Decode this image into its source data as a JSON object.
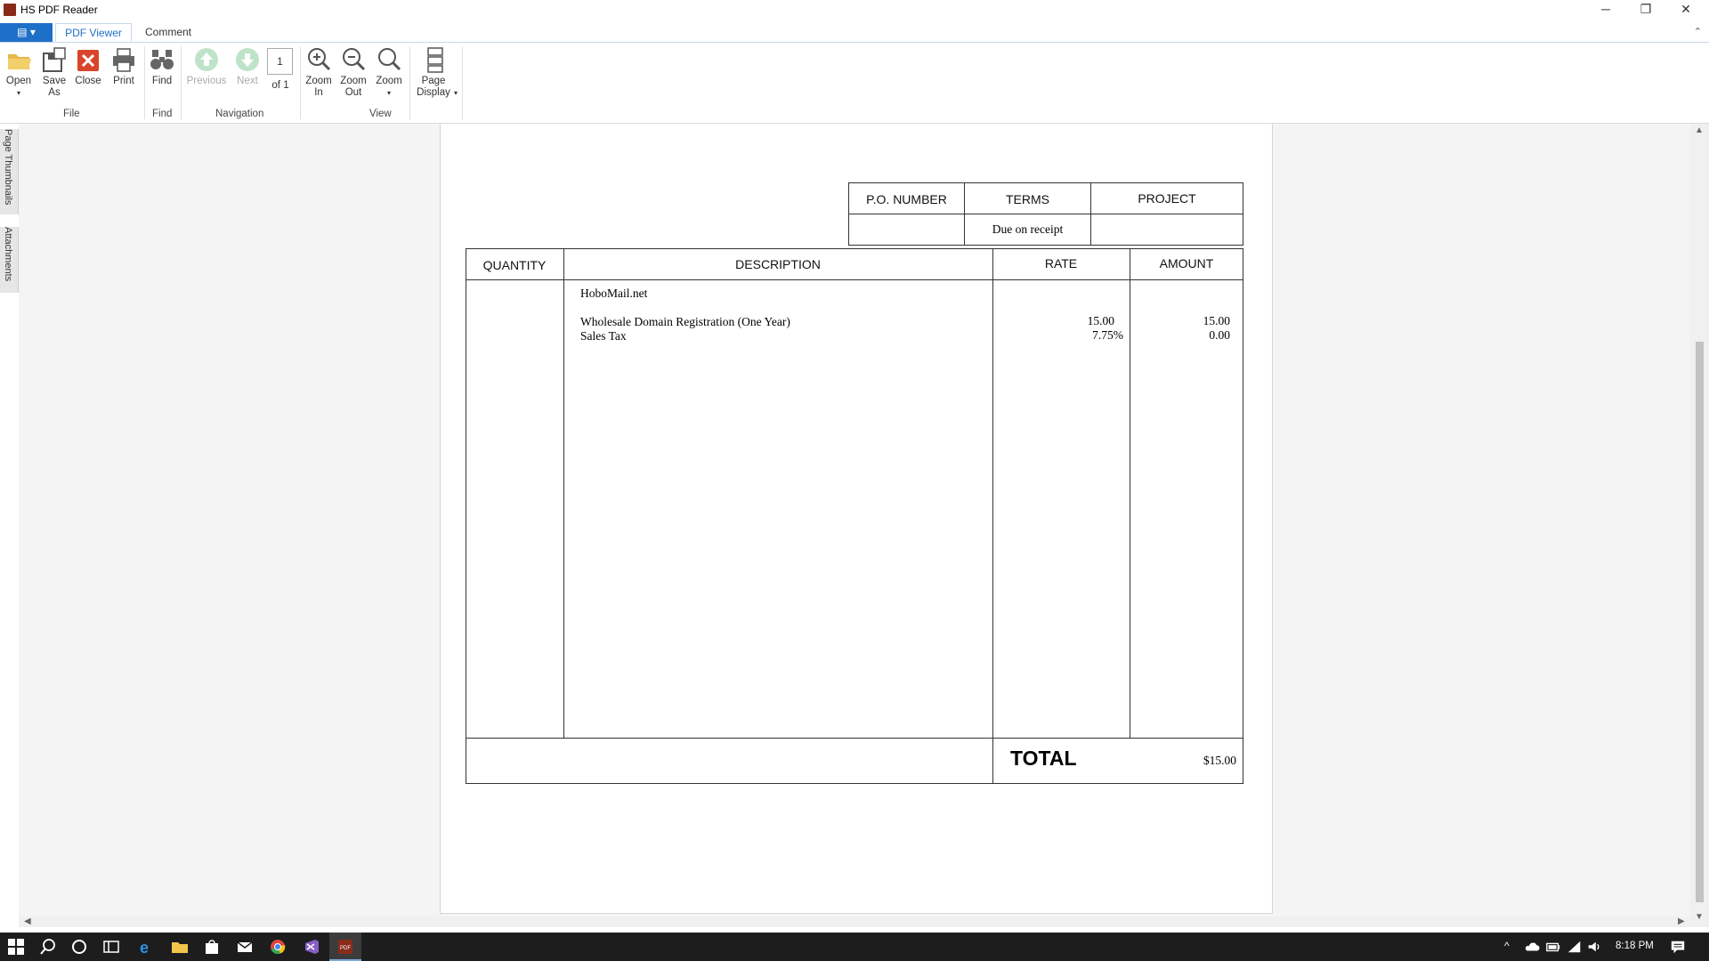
{
  "window": {
    "title": "HS PDF Reader",
    "minimize": "─",
    "restore": "❐",
    "close": "✕"
  },
  "tabs": {
    "app_menu": "▤ ▾",
    "pdf_viewer": "PDF Viewer",
    "comment": "Comment",
    "collapse": "⌃"
  },
  "ribbon": {
    "open": "Open",
    "open_arrow": "▾",
    "save_as": "Save As",
    "close": "Close",
    "print": "Print",
    "find": "Find",
    "previous": "Previous",
    "next": "Next",
    "page_number": "1",
    "of_pages": "of 1",
    "zoom_in": "Zoom In",
    "zoom_out": "Zoom Out",
    "zoom": "Zoom",
    "zoom_arrow": "▾",
    "page_display": "Page Display",
    "page_display_arrow": "▾",
    "groups": {
      "file": "File",
      "find": "Find",
      "navigation": "Navigation",
      "view": "View"
    }
  },
  "side_tabs": {
    "thumbnails": "Page Thumbnails",
    "attachments": "Attachments"
  },
  "invoice": {
    "po_number_header": "P.O. NUMBER",
    "terms_header": "TERMS",
    "project_header": "PROJECT",
    "po_number_value": "",
    "terms_value": "Due on receipt",
    "project_value": "",
    "quantity_header": "QUANTITY",
    "description_header": "DESCRIPTION",
    "rate_header": "RATE",
    "amount_header": "AMOUNT",
    "lines": [
      {
        "description": "HoboMail.net",
        "rate": "",
        "amount": ""
      },
      {
        "description": "Wholesale Domain Registration (One Year)",
        "rate": "15.00",
        "amount": "15.00"
      },
      {
        "description": "Sales Tax",
        "rate": "7.75%",
        "amount": "0.00"
      }
    ],
    "total_label": "TOTAL",
    "total_value": "$15.00"
  },
  "taskbar": {
    "time": "8:18 PM"
  },
  "colors": {
    "accent": "#1e6fc7",
    "taskbar": "#1d1d1d",
    "close_red": "#d9452b"
  }
}
